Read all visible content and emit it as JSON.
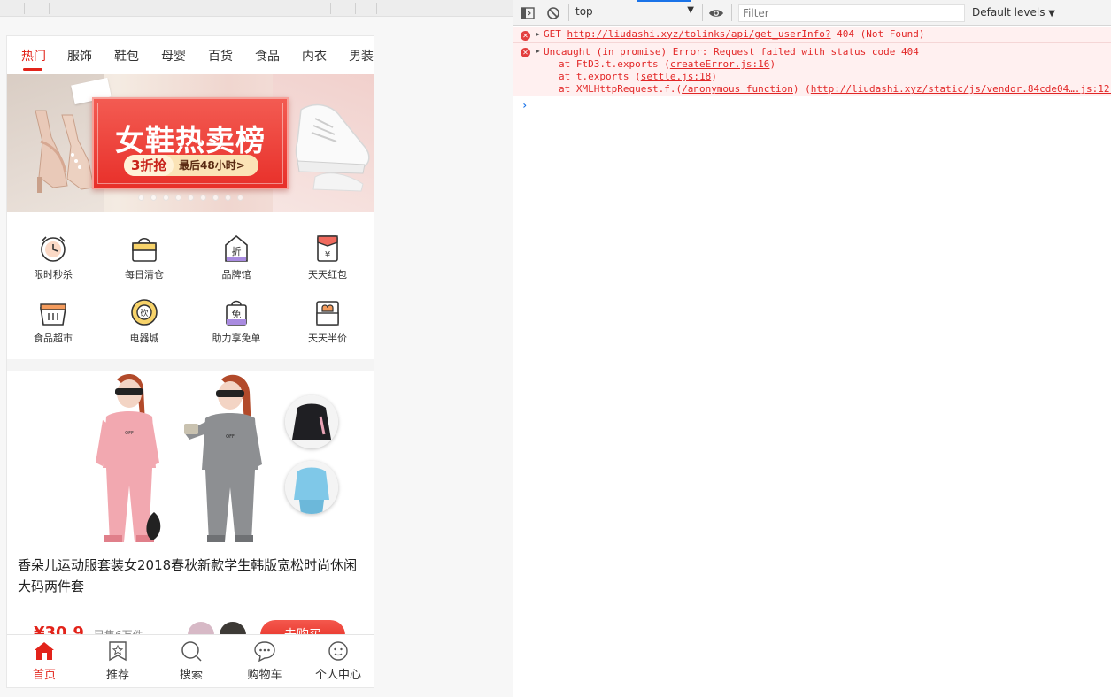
{
  "phone": {
    "categories": [
      "热门",
      "服饰",
      "鞋包",
      "母婴",
      "百货",
      "食品",
      "内衣",
      "男装"
    ],
    "banner": {
      "title": "女鞋热卖榜",
      "badge": "3折抢",
      "subtitle": "最后48小时>"
    },
    "grid": [
      "限时秒杀",
      "每日清仓",
      "品牌馆",
      "天天红包",
      "食品超市",
      "电器城",
      "助力享免单",
      "天天半价"
    ],
    "grid_icon_text": [
      "折",
      "¥",
      "砍",
      "免"
    ],
    "product": {
      "title": "香朵儿运动服套装女2018春秋新款学生韩版宽松时尚休闲大码两件套",
      "price": "¥30.9",
      "sold": "已售6万件",
      "buy_label": "去购买",
      "shirt_text": "OFF"
    },
    "bottom_nav": [
      "首页",
      "推荐",
      "搜索",
      "购物车",
      "个人中心"
    ]
  },
  "devtools": {
    "context": "top",
    "filter_placeholder": "Filter",
    "levels": "Default levels",
    "messages": [
      {
        "prefix": "GET ",
        "url": "http://liudashi.xyz/tolinks/api/get_userInfo?",
        "suffix": " 404 (Not Found)"
      },
      {
        "text": "Uncaught (in promise) Error: Request failed with status code 404",
        "stack": [
          {
            "pre": "at FtD3.t.exports (",
            "link": "createError.js:16",
            "post": ")"
          },
          {
            "pre": "at t.exports (",
            "link": "settle.js:18",
            "post": ")"
          },
          {
            "pre": "at XMLHttpRequest.f.(",
            "link": "/anonymous function",
            "post": ") (",
            "link2": "http://liudashi.xyz/static/js/vendor.84cde04….js:12:"
          }
        ]
      }
    ],
    "prompt": "›"
  }
}
